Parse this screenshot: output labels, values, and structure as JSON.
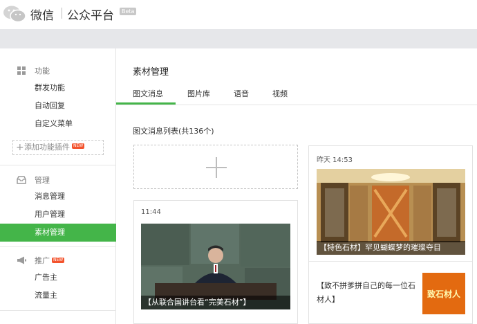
{
  "header": {
    "app_name": "微信",
    "platform": "公众平台",
    "beta": "Beta"
  },
  "sidebar": {
    "sections": [
      {
        "title": "功能",
        "icon": "grid-icon",
        "items": [
          "群发功能",
          "自动回复",
          "自定义菜单"
        ],
        "add_plugin": "添加功能插件",
        "add_badge": "NEW"
      },
      {
        "title": "管理",
        "icon": "inbox-icon",
        "items": [
          "消息管理",
          "用户管理",
          "素材管理"
        ],
        "active": "素材管理"
      },
      {
        "title": "推广",
        "icon": "megaphone-icon",
        "badge": "NEW",
        "items": [
          "广告主",
          "流量主"
        ]
      }
    ]
  },
  "main": {
    "title": "素材管理",
    "tabs": [
      "图文消息",
      "图片库",
      "语音",
      "视频"
    ],
    "active_tab": "图文消息",
    "list_title": "图文消息列表(共136个)",
    "cards": [
      {
        "time": "11:44",
        "caption": "【从联合国讲台看“完美石材”】"
      },
      {
        "time": "昨天 14:53",
        "caption": "【特色石材】罕见蝴蝶梦的璀璨夺目",
        "sub_title": "【致不拼爹拼自己的每一位石材人】",
        "sub_thumb_text": "致石材人"
      }
    ]
  },
  "colors": {
    "accent": "#44b549",
    "badge": "#f3532d"
  }
}
